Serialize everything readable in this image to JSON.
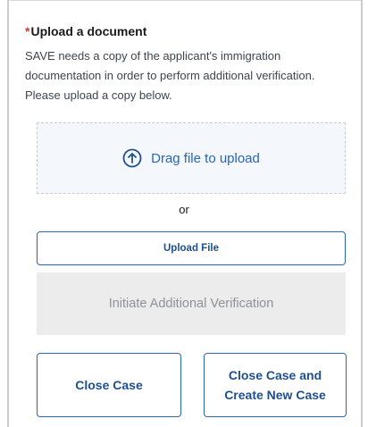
{
  "section": {
    "required_marker": "*",
    "title": "Upload a document",
    "description": "SAVE needs a copy of the applicant's immigration documentation in order to perform additional verification. Please upload a copy below."
  },
  "dropzone": {
    "icon": "upload-arrow-icon",
    "label": "Drag file to upload"
  },
  "separator": "or",
  "buttons": {
    "upload_file": "Upload File",
    "initiate_verification": "Initiate Additional Verification",
    "close_case": "Close Case",
    "close_and_create": "Close Case and Create New Case"
  },
  "colors": {
    "accent": "#2765b8",
    "required": "#d83933",
    "disabled_bg": "#ececec",
    "disabled_text": "#8d9297",
    "dropzone_bg": "#f4f8fc"
  }
}
